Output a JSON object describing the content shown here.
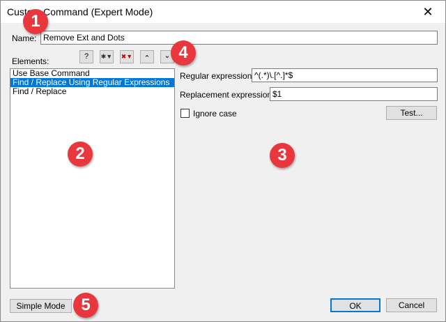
{
  "window": {
    "title": "Custom Command (Expert Mode)",
    "close": "✕"
  },
  "name": {
    "label": "Name:",
    "value": "Remove Ext and Dots"
  },
  "elements": {
    "label": "Elements:",
    "toolbar": {
      "help": "?",
      "add": "✱▼",
      "remove": "✖▼",
      "up": "⌃",
      "down": "⌄"
    },
    "items": [
      {
        "label": "Use Base Command",
        "selected": false
      },
      {
        "label": "Find / Replace Using Regular Expressions",
        "selected": true
      },
      {
        "label": "Find / Replace",
        "selected": false
      }
    ]
  },
  "settings": {
    "regex_label": "Regular expression:",
    "regex_value": "^(.*)\\.[^.]*$",
    "replacement_label": "Replacement expression:",
    "replacement_value": "$1",
    "ignore_case_label": "Ignore case",
    "ignore_case_checked": false,
    "test_label": "Test..."
  },
  "footer": {
    "simple_mode": "Simple Mode",
    "ok": "OK",
    "cancel": "Cancel"
  },
  "badges": [
    "1",
    "2",
    "3",
    "4",
    "5"
  ],
  "colors": {
    "selection": "#0078d7",
    "badge": "#e8383d"
  }
}
